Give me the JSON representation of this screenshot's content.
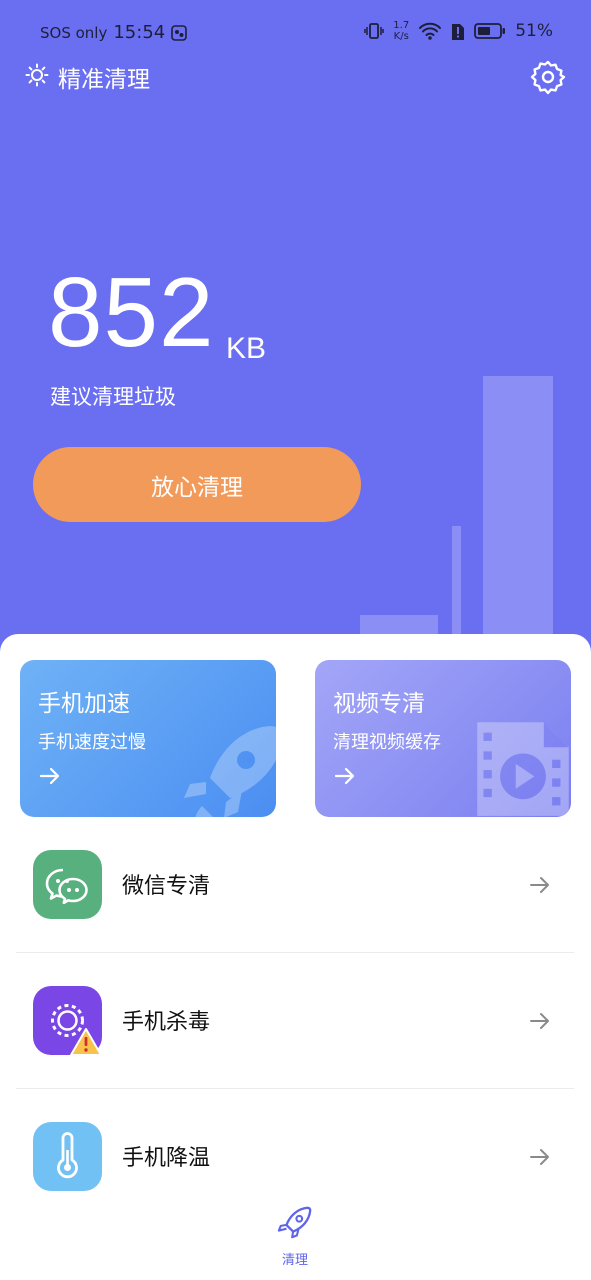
{
  "status_bar": {
    "carrier": "SOS only",
    "time": "15:54",
    "net_speed_value": "1.7",
    "net_speed_unit": "K/s",
    "battery": "51%"
  },
  "app_bar": {
    "title": "精准清理",
    "sun_icon": "sun-icon",
    "settings_icon": "gear-icon"
  },
  "summary": {
    "junk_size": "852",
    "junk_unit": "KB",
    "caption": "建议清理垃圾",
    "clean_button": "放心清理"
  },
  "feature_cards": [
    {
      "title": "手机加速",
      "subtitle": "手机速度过慢",
      "icon": "rocket-icon"
    },
    {
      "title": "视频专清",
      "subtitle": "清理视频缓存",
      "icon": "video-file-icon"
    }
  ],
  "list_items": [
    {
      "label": "微信专清",
      "icon": "wechat-icon"
    },
    {
      "label": "手机杀毒",
      "icon": "virus-warning-icon"
    },
    {
      "label": "手机降温",
      "icon": "thermometer-icon"
    }
  ],
  "bottom_nav": {
    "items": [
      {
        "label": "清理",
        "icon": "rocket-icon"
      }
    ]
  },
  "colors": {
    "hero_bg": "#6a6ff2",
    "cta": "#f29a5a",
    "wechat_green": "#57b07e",
    "virus_purple": "#7a46e6",
    "temp_blue": "#72c1f5",
    "accent": "#5f64e8"
  }
}
